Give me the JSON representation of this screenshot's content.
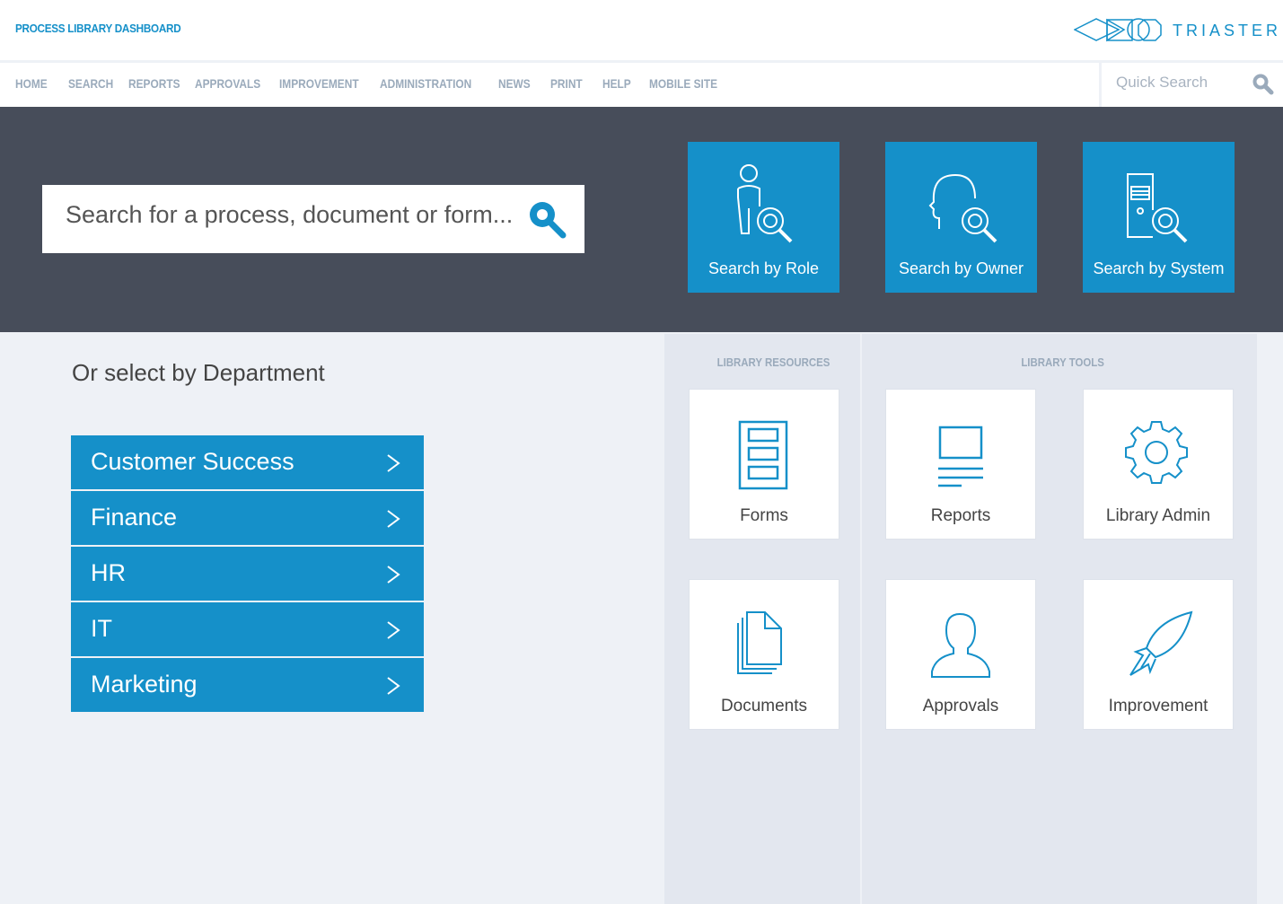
{
  "header": {
    "title": "PROCESS LIBRARY DASHBOARD",
    "logo_text": "TRIASTER"
  },
  "nav": {
    "items": [
      "HOME",
      "SEARCH",
      "REPORTS",
      "APPROVALS",
      "IMPROVEMENT",
      "ADMINISTRATION",
      "NEWS",
      "PRINT",
      "HELP",
      "MOBILE SITE"
    ],
    "quick_search_placeholder": "Quick Search"
  },
  "hero": {
    "search_placeholder": "Search for a process, document or form...",
    "tiles": [
      {
        "label": "Search by Role",
        "icon": "role-search-icon"
      },
      {
        "label": "Search by Owner",
        "icon": "owner-search-icon"
      },
      {
        "label": "Search by System",
        "icon": "system-search-icon"
      }
    ]
  },
  "departments": {
    "title": "Or select by Department",
    "items": [
      "Customer Success",
      "Finance",
      "HR",
      "IT",
      "Marketing"
    ]
  },
  "resources": {
    "title": "LIBRARY RESOURCES",
    "items": [
      {
        "label": "Forms",
        "icon": "forms-icon"
      },
      {
        "label": "Documents",
        "icon": "documents-icon"
      }
    ]
  },
  "tools": {
    "title": "LIBRARY TOOLS",
    "items": [
      {
        "label": "Reports",
        "icon": "reports-icon"
      },
      {
        "label": "Library Admin",
        "icon": "gear-icon"
      },
      {
        "label": "Approvals",
        "icon": "user-icon"
      },
      {
        "label": "Improvement",
        "icon": "rocket-icon"
      }
    ]
  },
  "colors": {
    "brand": "#1590c9",
    "band": "#474d5a",
    "background": "#eef1f6",
    "panel": "#e3e7ef",
    "nav_text": "#9aaabb"
  }
}
